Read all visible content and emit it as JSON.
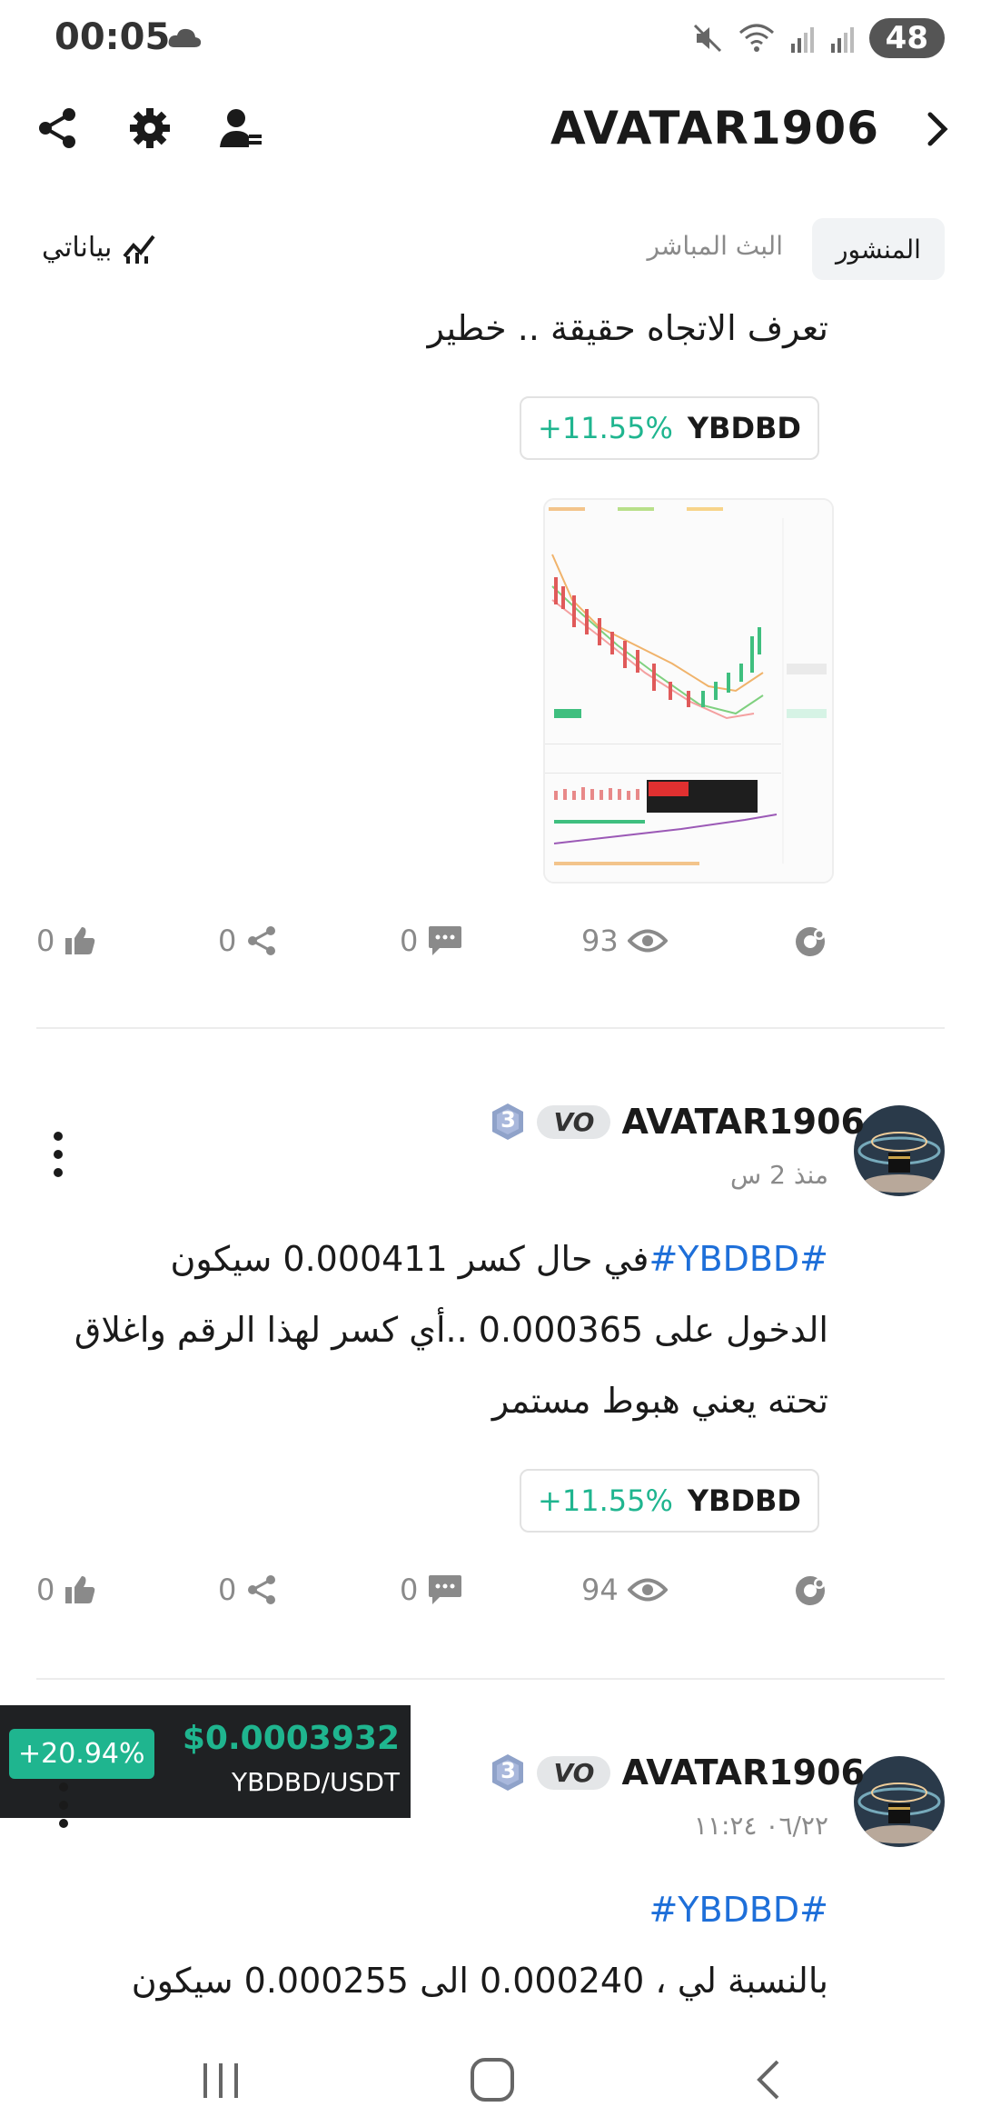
{
  "status_bar": {
    "time": "00:05",
    "battery": "48"
  },
  "header": {
    "title": "AVATAR1906"
  },
  "tabs": {
    "active": "المنشور",
    "live": "البث المباشر",
    "my_data": "بياناتي"
  },
  "post1": {
    "text": "تعرف الاتجاه حقيقة .. خطير",
    "chip": {
      "symbol": "YBDBD",
      "change": "+11.55%"
    },
    "actions": {
      "likes": "0",
      "shares": "0",
      "comments": "0",
      "views": "93"
    }
  },
  "post2": {
    "username": "AVATAR1906",
    "badge": "VO",
    "level": "3",
    "time": "منذ 2 س",
    "line1_tag": "#YBDBD#",
    "line1": "في حال كسر 0.000411  سيكون",
    "line2": "الدخول على 0.000365 ..أي كسر لهذا الرقم واغلاق",
    "line3": "تحته يعني هبوط مستمر",
    "chip": {
      "symbol": "YBDBD",
      "change": "+11.55%"
    },
    "actions": {
      "likes": "0",
      "shares": "0",
      "comments": "0",
      "views": "94"
    }
  },
  "post3": {
    "username": "AVATAR1906",
    "badge": "VO",
    "level": "3",
    "time": "٠٦/٢٢ ١١:٢٤",
    "tag": "#YBDBD#",
    "line1": "بالنسبة لي ، 0.000240 الى 0.000255 سيكون"
  },
  "ticker": {
    "change": "+20.94%",
    "price": "$0.0003932",
    "pair": "YBDBD/USDT"
  },
  "colors": {
    "green": "#1fb58f",
    "blue": "#1e6fd9",
    "ticker_bg": "#1f2123"
  }
}
